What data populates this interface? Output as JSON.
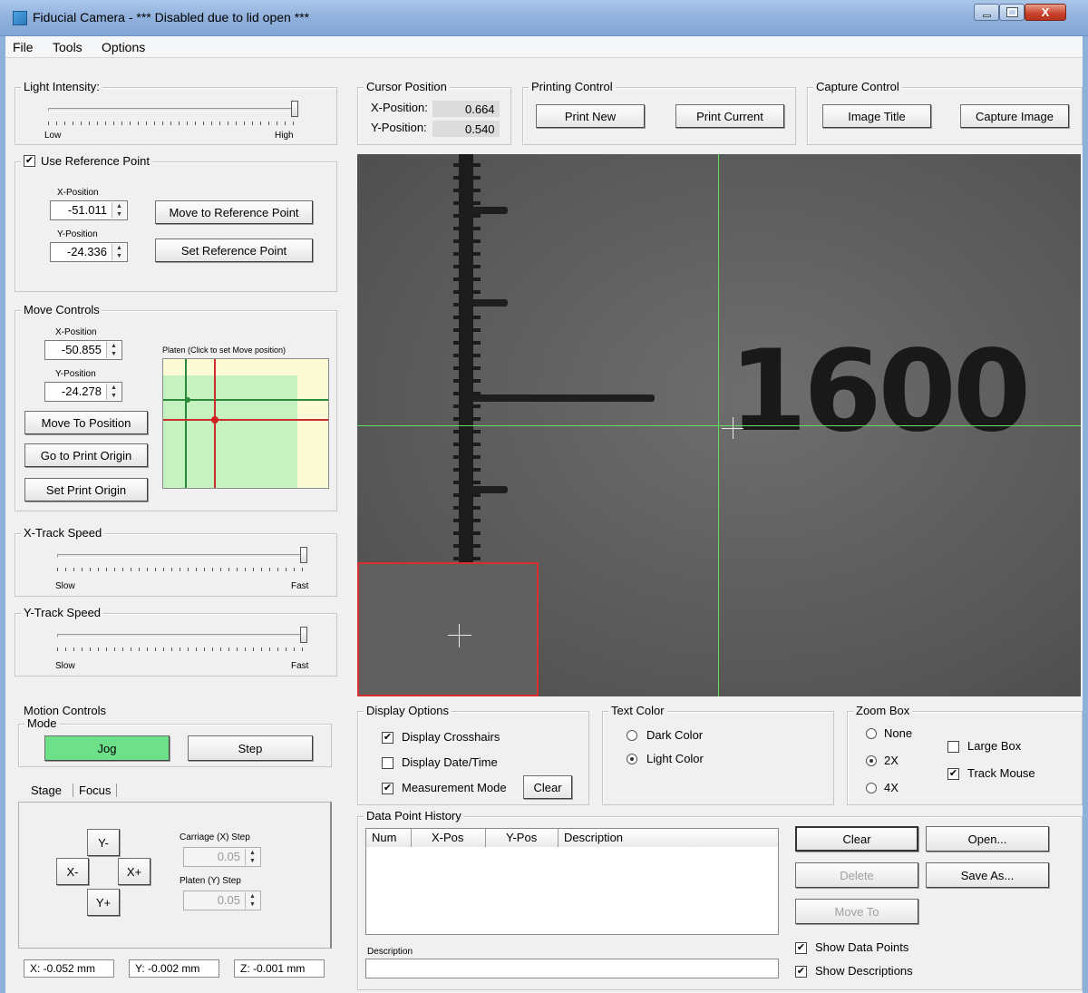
{
  "window": {
    "title": "Fiducial Camera  - *** Disabled due to lid open ***",
    "close_glyph": "X"
  },
  "menu": [
    "File",
    "Tools",
    "Options"
  ],
  "light_intensity": {
    "title": "Light Intensity:",
    "min_label": "Low",
    "max_label": "High",
    "level": 1.0
  },
  "reference": {
    "title": "Use Reference Point",
    "checked_glyph": "✔",
    "x_label": "X-Position",
    "x_value": "-51.011",
    "y_label": "Y-Position",
    "y_value": "-24.336",
    "move_button": "Move to Reference Point",
    "set_button": "Set Reference Point"
  },
  "move_controls": {
    "title": "Move Controls",
    "x_label": "X-Position",
    "x_value": "-50.855",
    "y_label": "Y-Position",
    "y_value": "-24.278",
    "platen_label": "Platen (Click to set Move position)",
    "move_button": "Move To Position",
    "origin_button": "Go to Print Origin",
    "set_origin_button": "Set Print Origin"
  },
  "x_track": {
    "title": "X-Track Speed",
    "min_label": "Slow",
    "max_label": "Fast",
    "level": 1.0
  },
  "y_track": {
    "title": "Y-Track Speed",
    "min_label": "Slow",
    "max_label": "Fast",
    "level": 1.0
  },
  "motion": {
    "title": "Motion Controls",
    "mode_title": "Mode",
    "jog": "Jog",
    "step": "Step",
    "tabs": [
      "Stage",
      "Focus"
    ],
    "y_minus": "Y-",
    "x_minus": "X-",
    "x_plus": "X+",
    "y_plus": "Y+",
    "carriage_label": "Carriage (X) Step",
    "carriage_value": "0.05",
    "platen_label": "Platen (Y) Step",
    "platen_value": "0.05",
    "readout_x": "X: -0.052 mm",
    "readout_y": "Y: -0.002 mm",
    "readout_z": "Z: -0.001 mm"
  },
  "cursor": {
    "title": "Cursor Position",
    "x_label": "X-Position:",
    "x_value": "0.664",
    "y_label": "Y-Position:",
    "y_value": "0.540"
  },
  "printing": {
    "title": "Printing Control",
    "print_new": "Print New",
    "print_current": "Print Current"
  },
  "capture": {
    "title": "Capture Control",
    "image_title": "Image Title",
    "capture_image": "Capture Image"
  },
  "camera": {
    "scale_text": "1600"
  },
  "display_options": {
    "title": "Display Options",
    "crosshairs": "Display Crosshairs",
    "datetime": "Display Date/Time",
    "measurement": "Measurement Mode",
    "clear": "Clear",
    "checked_glyph": "✔"
  },
  "text_color": {
    "title": "Text Color",
    "dark": "Dark Color",
    "light": "Light Color"
  },
  "zoom_box": {
    "title": "Zoom Box",
    "none": "None",
    "x2": "2X",
    "x4": "4X",
    "large": "Large Box",
    "track": "Track Mouse",
    "checked_glyph": "✔"
  },
  "history": {
    "title": "Data Point History",
    "columns": [
      "Num",
      "X-Pos",
      "Y-Pos",
      "Description"
    ],
    "description_label": "Description",
    "clear": "Clear",
    "open": "Open...",
    "delete": "Delete",
    "save_as": "Save As...",
    "move_to": "Move To",
    "show_points": "Show Data Points",
    "show_desc": "Show Descriptions",
    "checked_glyph": "✔"
  },
  "colors": {
    "crosshair": "#5fe05f",
    "zoom_box": "#d83030",
    "jog_active": "#6fe08a",
    "platen_green": "#c5f2c0",
    "platen_yellow": "#fbfbd6"
  }
}
